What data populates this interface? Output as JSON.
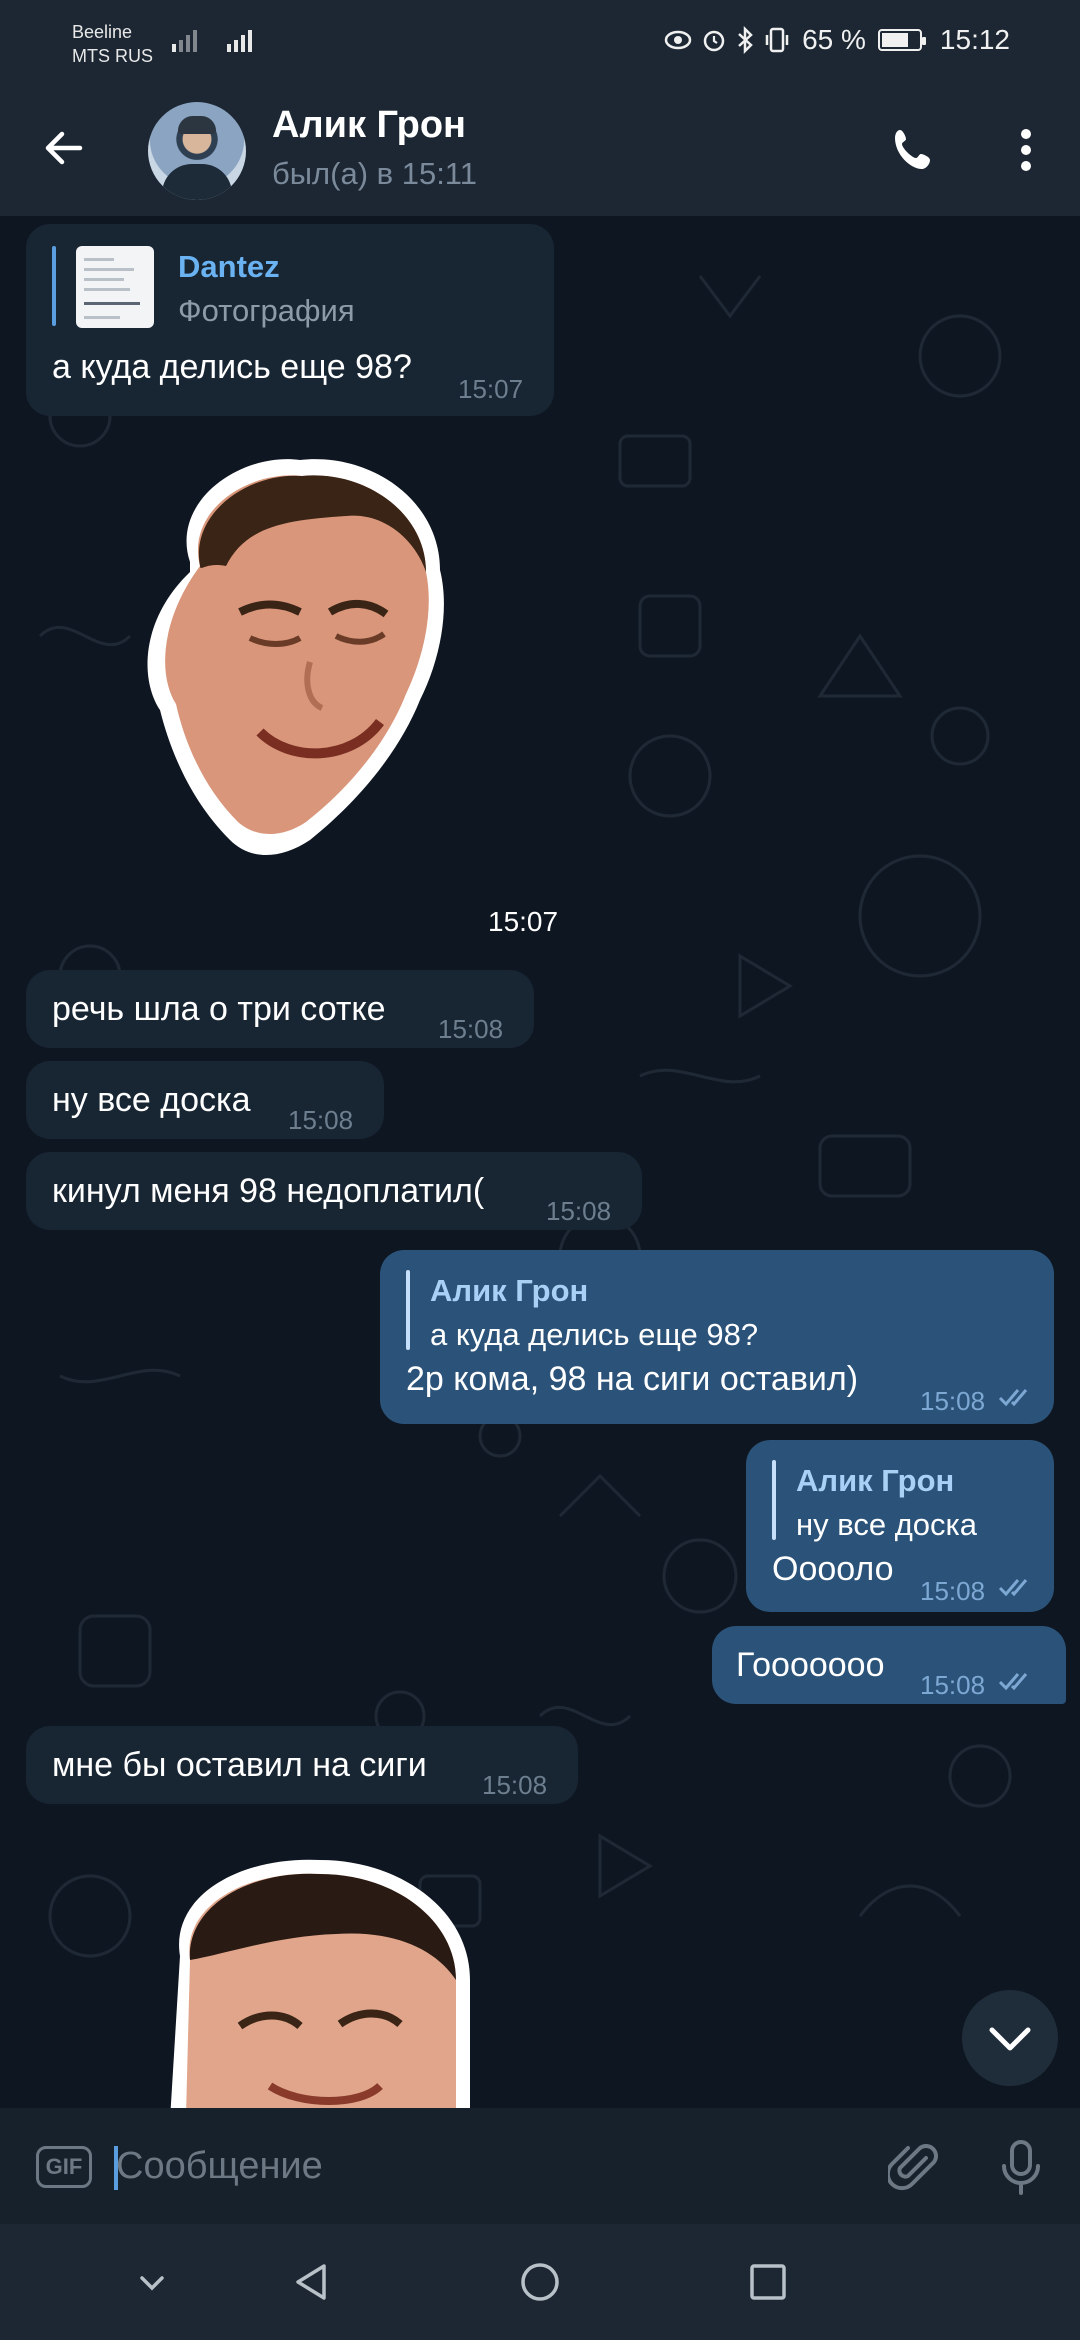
{
  "status_bar": {
    "carrier1": "Beeline",
    "carrier2": "MTS RUS",
    "battery": "65 %",
    "time": "15:12"
  },
  "header": {
    "name": "Алик Грон",
    "status": "был(а) в 15:11"
  },
  "messages": {
    "m1": {
      "reply_name": "Dantez",
      "reply_text": "Фотография",
      "text": "а куда делись еще 98?",
      "time": "15:07"
    },
    "sticker1_time": "15:07",
    "m2": {
      "text": "речь шла о три сотке",
      "time": "15:08"
    },
    "m3": {
      "text": "ну все доска",
      "time": "15:08"
    },
    "m4": {
      "text": "кинул меня 98 недоплатил(",
      "time": "15:08"
    },
    "m5": {
      "reply_name": "Алик Грон",
      "reply_text": "а куда делись еще 98?",
      "text": "2р кома, 98 на сиги оставил)",
      "time": "15:08"
    },
    "m6": {
      "reply_name": "Алик Грон",
      "reply_text": "ну все доска",
      "text": "Ооооло",
      "time": "15:08"
    },
    "m7": {
      "text": "Гооооооо",
      "time": "15:08"
    },
    "m8": {
      "text": "мне бы оставил на сиги",
      "time": "15:08"
    }
  },
  "input": {
    "gif_label": "GIF",
    "placeholder": "Сообщение"
  },
  "colors": {
    "background": "#0e1621",
    "incoming": "#182533",
    "outgoing": "#2b5278",
    "accent": "#6ab2f2"
  },
  "icons": [
    "back-arrow-icon",
    "phone-icon",
    "more-vert-icon",
    "gif-icon",
    "paperclip-icon",
    "microphone-icon",
    "chevron-down-icon",
    "nav-back-icon",
    "nav-home-icon",
    "nav-recents-icon"
  ]
}
